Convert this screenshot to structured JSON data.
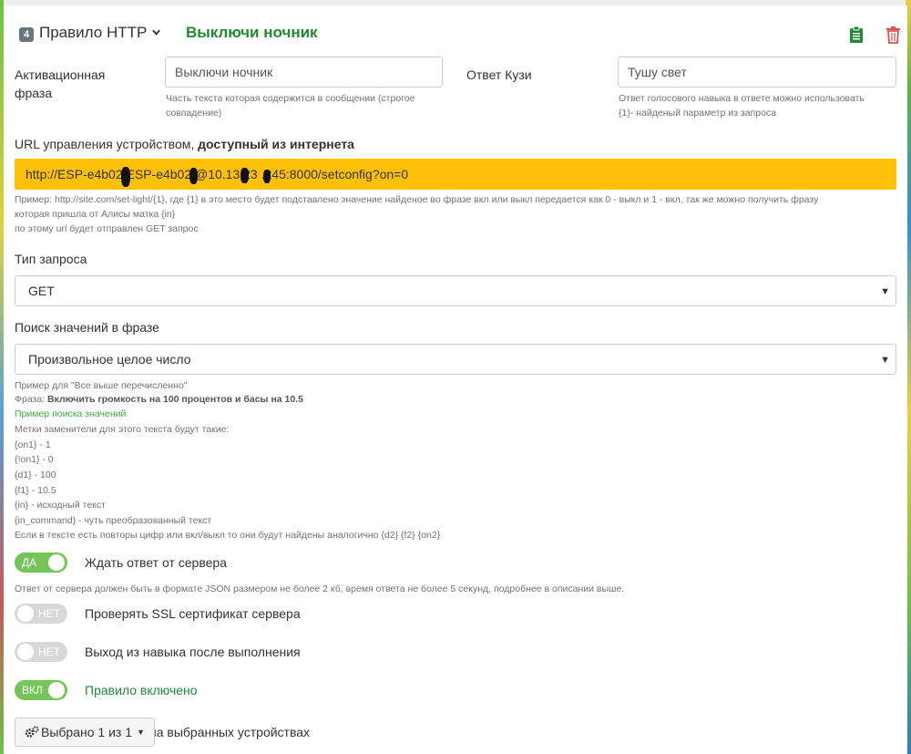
{
  "header": {
    "rule_number": "4",
    "rule_type": "Правило HTTP",
    "rule_name": "Выключи ночник"
  },
  "activation": {
    "label": "Активационная фраза",
    "value": "Выключи ночник",
    "help": "Часть текста которая содержится в сообщении (строгое совпадение)"
  },
  "response": {
    "label": "Ответ Кузи",
    "value": "Тушу свет",
    "help_line1": "Ответ голосового навыка в ответе можно использовать",
    "help_line2": "{1}- найденый параметр из запроса"
  },
  "url": {
    "label_plain": "URL управления устройством, ",
    "label_bold": "доступный из интернета",
    "value": "http://ESP-e4b02  ESP-e4b02  @10.13  23  .245:8000/setconfig?on=0",
    "help_line1": "Пример: http://site.com/set-light/{1}, где {1} в это место будет подставлено значение найденое во фразе вкл или выкл передается как 0 - выкл и 1 - вкл, так же можно получить фразу",
    "help_line2": "которая пришла от Алисы матка {in}",
    "help_line3": "по этому url будет отправлен GET запрос"
  },
  "request_type": {
    "label": "Тип запроса",
    "value": "GET"
  },
  "search": {
    "label": "Поиск значений в фразе",
    "value": "Произвольное целое число",
    "help": {
      "example_title": "Пример для \"Все выше перечисленно\"",
      "phrase_prefix": "Фраза: ",
      "phrase_bold": "Включить громкость на 100 процентов и басы на 10.5",
      "example_link": "Пример поиска значений",
      "markers_title": "Метки заменители для этого текста будут такие:",
      "m1": "{on1} - 1",
      "m2": "{!on1} - 0",
      "m3": "{d1} - 100",
      "m4": "{f1} - 10.5",
      "m5": "{in} - исходный текст",
      "m6": "{in_command} - чуть преобразованный текст",
      "repeat_note": "Если в тексте есть повторы цифр или вкл/выкл то они будут найдены аналогично {d2} {f2} {on2}"
    }
  },
  "toggles": {
    "wait_response": {
      "state": "ДА",
      "label": "Ждать ответ от сервера",
      "on": true
    },
    "wait_help": "Ответ от сервера должен быть в формате JSON размером не более 2 кб, время ответа не более 5 секунд, подробнее в описании выше.",
    "check_ssl": {
      "state": "НЕТ",
      "label": "Проверять SSL сертификат сервера",
      "on": false
    },
    "exit_skill": {
      "state": "НЕТ",
      "label": "Выход из навыка после выполнения",
      "on": false
    },
    "rule_enabled": {
      "state": "ВКЛ",
      "label": "Правило включено",
      "on": true
    }
  },
  "devices": {
    "button_label": "Выбрано 1 из 1",
    "trailing_text": "на выбранных устройствах"
  },
  "colors": {
    "accent_green": "#1f8a33",
    "url_highlight": "#ffc107",
    "toggle_on": "#75c55b",
    "toggle_off": "#d8d8d8",
    "delete_red": "#d9534f"
  },
  "icons": [
    "chevron-down-icon",
    "clipboard-icon",
    "trash-icon",
    "gear-icon",
    "caret-down-icon"
  ]
}
